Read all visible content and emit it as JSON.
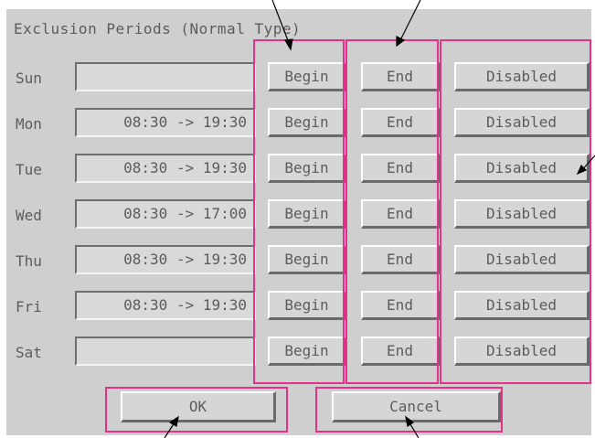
{
  "dialog": {
    "title": "Exclusion Periods (Normal Type)"
  },
  "days": [
    {
      "day": "Sun",
      "period": "",
      "begin": "Begin",
      "end": "End",
      "disabled": "Disabled"
    },
    {
      "day": "Mon",
      "period": "08:30 -> 19:30",
      "begin": "Begin",
      "end": "End",
      "disabled": "Disabled"
    },
    {
      "day": "Tue",
      "period": "08:30 -> 19:30",
      "begin": "Begin",
      "end": "End",
      "disabled": "Disabled"
    },
    {
      "day": "Wed",
      "period": "08:30 -> 17:00",
      "begin": "Begin",
      "end": "End",
      "disabled": "Disabled"
    },
    {
      "day": "Thu",
      "period": "08:30 -> 19:30",
      "begin": "Begin",
      "end": "End",
      "disabled": "Disabled"
    },
    {
      "day": "Fri",
      "period": "08:30 -> 19:30",
      "begin": "Begin",
      "end": "End",
      "disabled": "Disabled"
    },
    {
      "day": "Sat",
      "period": "",
      "begin": "Begin",
      "end": "End",
      "disabled": "Disabled"
    }
  ],
  "buttons": {
    "ok": "OK",
    "cancel": "Cancel"
  },
  "colors": {
    "highlight": "#e6308a",
    "panel": "#cfcfcf",
    "text": "#5c5c5c"
  }
}
